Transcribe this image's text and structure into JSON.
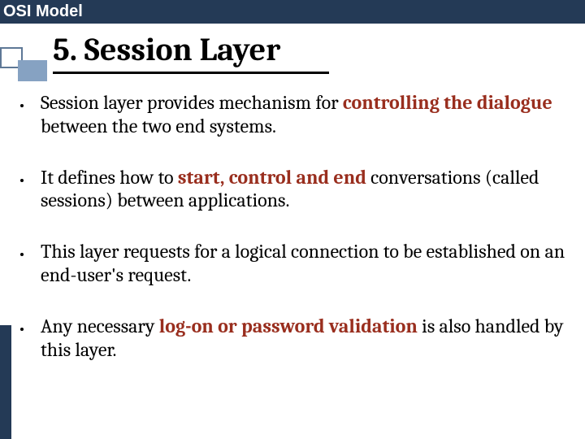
{
  "header": "OSI Model",
  "title": "5. Session Layer",
  "bullets": {
    "b1": {
      "p1": "Session layer provides mechanism for ",
      "h1": "controlling the dialogue",
      "p2": " between the two end systems."
    },
    "b2": {
      "p1": "It defines how to ",
      "h1": "start, control and end",
      "p2": " conversations (called sessions) between applications."
    },
    "b3": {
      "p1": "This layer requests for a logical connection to be established on an end-user's request."
    },
    "b4": {
      "p1": "Any necessary ",
      "h1": "log-on or password validation",
      "p2": " is also handled by this layer."
    }
  }
}
